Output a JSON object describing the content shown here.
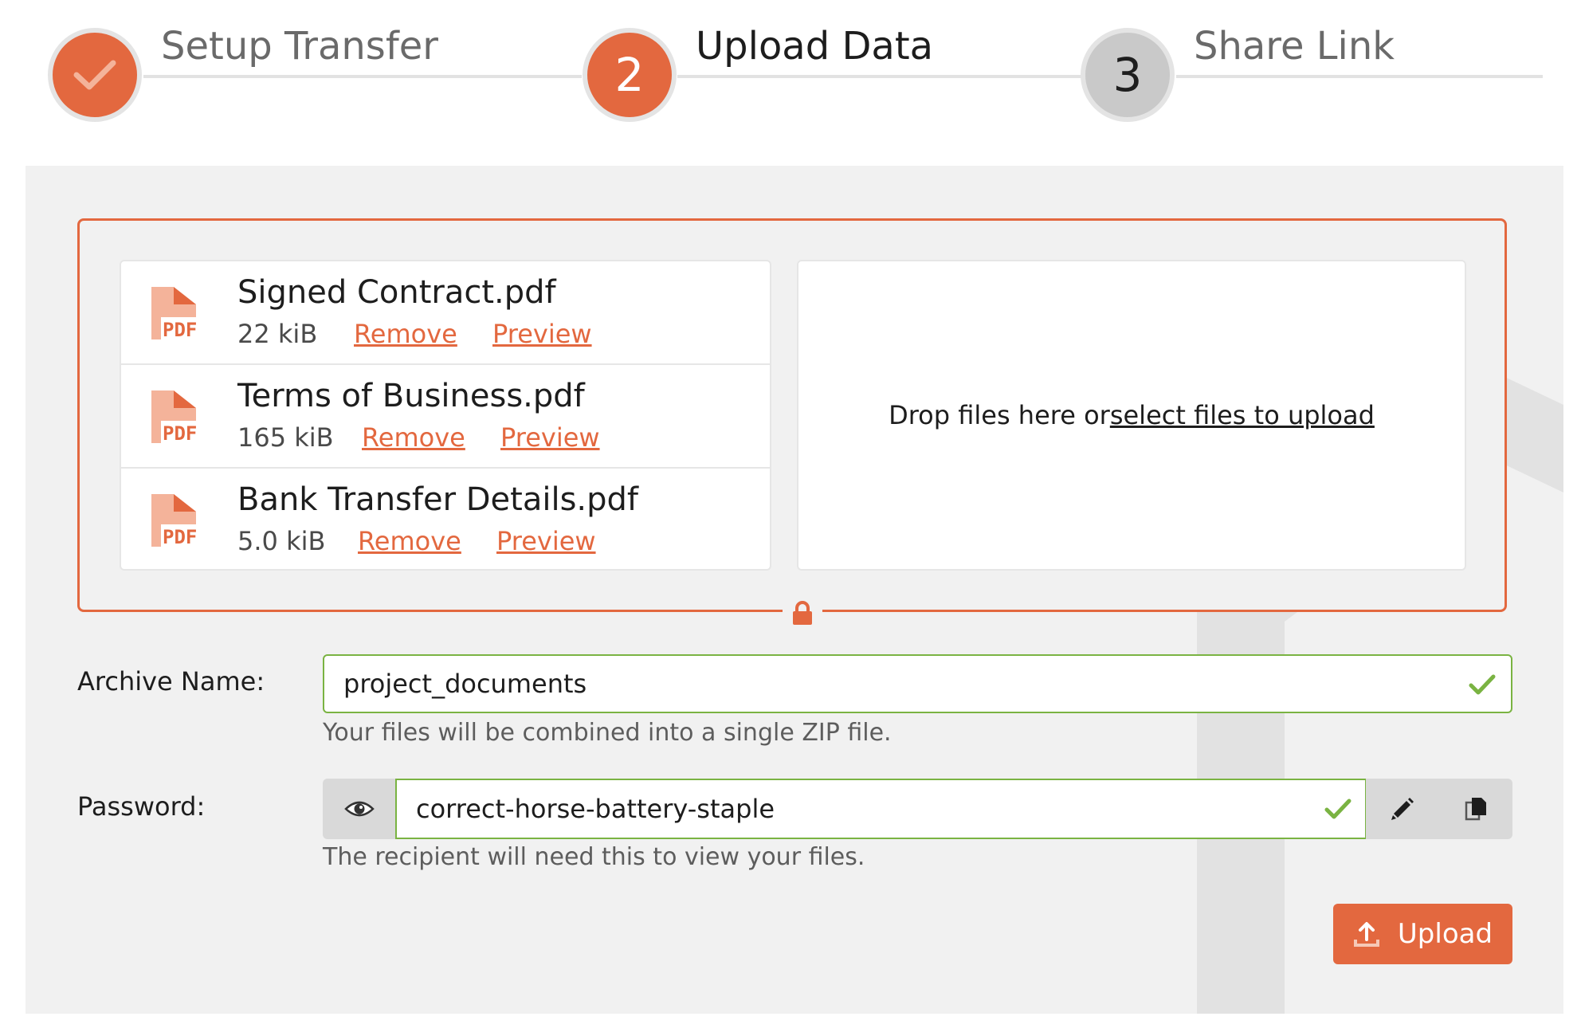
{
  "stepper": {
    "steps": [
      {
        "number": "",
        "label": "Setup Transfer",
        "state": "done"
      },
      {
        "number": "2",
        "label": "Upload Data",
        "state": "active"
      },
      {
        "number": "3",
        "label": "Share Link",
        "state": "todo"
      }
    ]
  },
  "files": [
    {
      "icon_label": "PDF",
      "name": "Signed Contract.pdf",
      "size": "22 kiB",
      "remove": "Remove",
      "preview": "Preview"
    },
    {
      "icon_label": "PDF",
      "name": "Terms of Business.pdf",
      "size": "165 kiB",
      "remove": "Remove",
      "preview": "Preview"
    },
    {
      "icon_label": "PDF",
      "name": "Bank Transfer Details.pdf",
      "size": "5.0 kiB",
      "remove": "Remove",
      "preview": "Preview"
    }
  ],
  "dropzone": {
    "text": "Drop files here or ",
    "link": "select files to upload"
  },
  "archive": {
    "label": "Archive Name:",
    "value": "project_documents",
    "help": "Your files will be combined into a single ZIP file."
  },
  "password": {
    "label": "Password:",
    "value": "correct-horse-battery-staple",
    "help": "The recipient will need this to view your files."
  },
  "upload_button": {
    "label": "Upload"
  },
  "colors": {
    "accent": "#e3683f",
    "valid": "#7ab342",
    "panel": "#f1f1f1"
  },
  "icons": [
    "checkmark-icon",
    "pdf-file-icon",
    "lock-icon",
    "eye-icon",
    "pencil-icon",
    "copy-icon",
    "upload-icon"
  ]
}
